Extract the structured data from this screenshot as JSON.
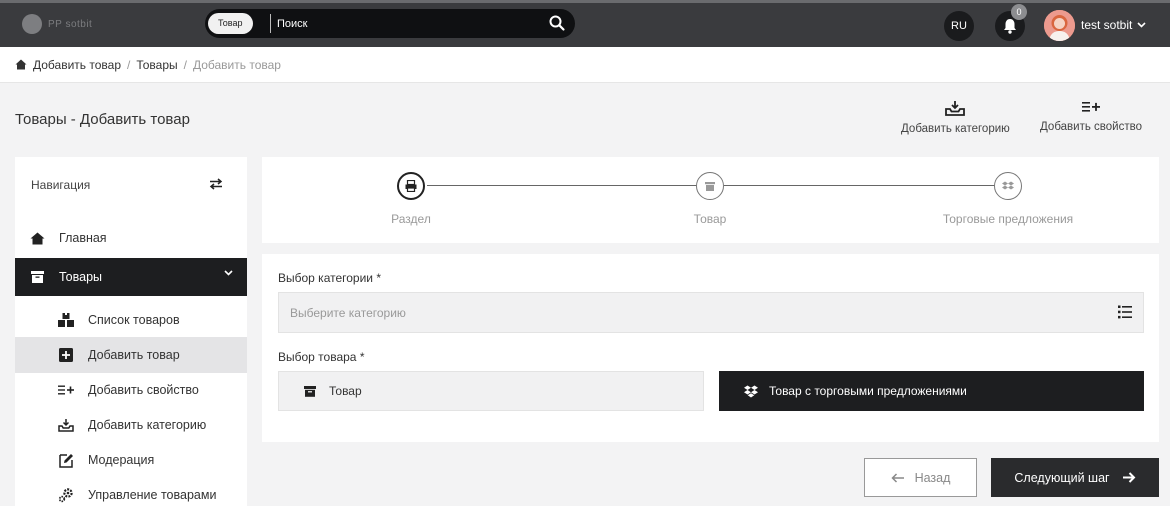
{
  "header": {
    "logo_text": "PP sotbit",
    "search_chip": "Товар",
    "search_placeholder": "Поиск",
    "lang": "RU",
    "notifications_count": "0",
    "user_name": "test sotbit"
  },
  "breadcrumb": {
    "home": "Добавить товар",
    "section": "Товары",
    "current": "Добавить товар",
    "separator": "/"
  },
  "page": {
    "title": "Товары - Добавить товар",
    "actions": {
      "add_category": "Добавить категорию",
      "add_property": "Добавить свойство"
    }
  },
  "sidebar": {
    "heading": "Навигация",
    "home": "Главная",
    "products": "Товары",
    "items": [
      {
        "label": "Список товаров",
        "icon": "boxes-icon"
      },
      {
        "label": "Добавить товар",
        "icon": "plus-square-icon"
      },
      {
        "label": "Добавить свойство",
        "icon": "list-plus-icon"
      },
      {
        "label": "Добавить категорию",
        "icon": "inbox-download-icon"
      },
      {
        "label": "Модерация",
        "icon": "edit-icon"
      },
      {
        "label": "Управление товарами",
        "icon": "gears-icon"
      }
    ]
  },
  "stepper": {
    "steps": [
      "Раздел",
      "Товар",
      "Торговые предложения"
    ],
    "active_index": 0
  },
  "form": {
    "category_label": "Выбор категории *",
    "category_placeholder": "Выберите категорию",
    "product_label": "Выбор товара *",
    "option_simple": "Товар",
    "option_offers": "Товар с торговыми предложениями"
  },
  "buttons": {
    "back": "Назад",
    "next": "Следующий шаг"
  },
  "colors": {
    "topbar": "#3a3b3e",
    "active_dark": "#1d1e20",
    "page_bg": "#f3f3f4"
  }
}
